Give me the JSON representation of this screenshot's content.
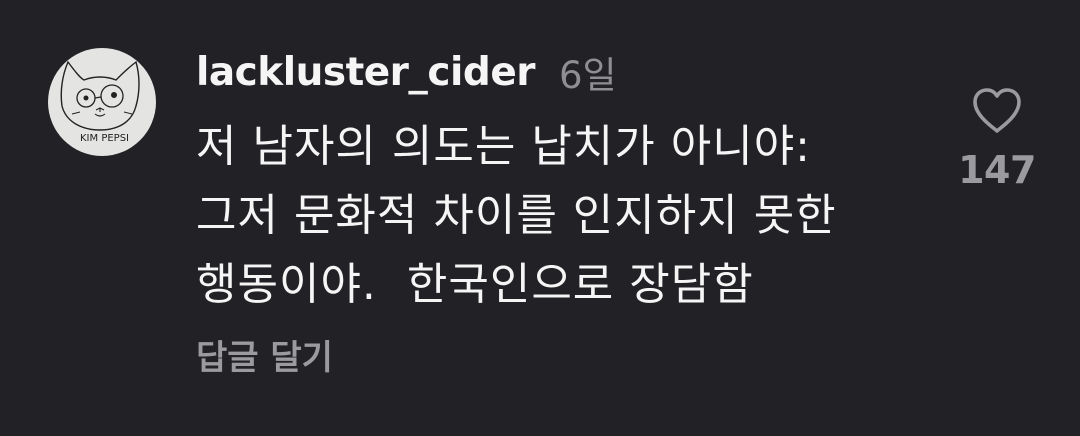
{
  "comment": {
    "username": "lackluster_cider",
    "timestamp": "6일",
    "avatar": {
      "description_icon": "cat-drawing-avatar",
      "signature_text": "KIM PEPSI"
    },
    "text_lines": [
      "저 남자의 의도는 납치가 아니야:",
      "그저 문화적 차이를 인지하지 못한",
      "행동이야.  한국인으로 장담함"
    ],
    "reply_label": "답글 달기",
    "like_icon": "heart-outline-icon",
    "like_count": "147"
  },
  "colors": {
    "background": "#212126",
    "primary_text": "#f5f5f5",
    "secondary_text": "#9a9a9f"
  }
}
